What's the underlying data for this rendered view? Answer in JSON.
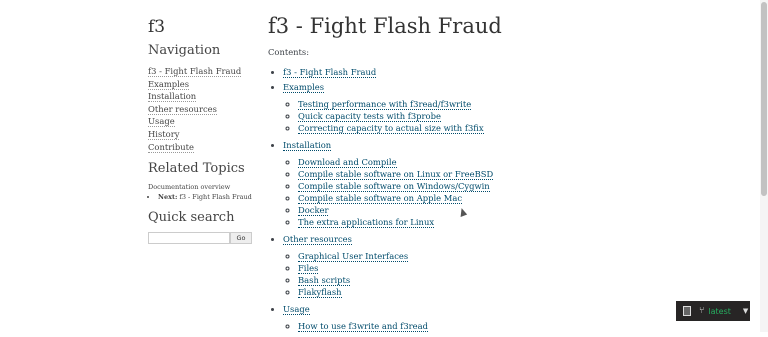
{
  "sidebar": {
    "logo": "f3",
    "navigation_heading": "Navigation",
    "nav_items": [
      "f3 - Fight Flash Fraud",
      "Examples",
      "Installation",
      "Other resources",
      "Usage",
      "History",
      "Contribute"
    ],
    "related_heading": "Related Topics",
    "related_caption": "Documentation overview",
    "related_next_label": "Next:",
    "related_next_link": "f3 - Fight Flash Fraud",
    "quick_search_heading": "Quick search",
    "search_button": "Go",
    "search_value": ""
  },
  "main": {
    "title": "f3 - Fight Flash Fraud",
    "contents_label": "Contents:",
    "toc": [
      {
        "label": "f3 - Fight Flash Fraud",
        "children": []
      },
      {
        "label": "Examples",
        "children": [
          "Testing performance with f3read/f3write",
          "Quick capacity tests with f3probe",
          "Correcting capacity to actual size with f3fix"
        ]
      },
      {
        "label": "Installation",
        "children": [
          "Download and Compile",
          "Compile stable software on Linux or FreeBSD",
          "Compile stable software on Windows/Cygwin",
          "Compile stable software on Apple Mac",
          "Docker",
          "The extra applications for Linux"
        ]
      },
      {
        "label": "Other resources",
        "children": [
          "Graphical User Interfaces",
          "Files",
          "Bash scripts",
          "Flakyflash"
        ]
      },
      {
        "label": "Usage",
        "children": [
          "How to use f3write and f3read"
        ]
      }
    ]
  },
  "badge": {
    "version": "latest",
    "book_icon": "book-icon",
    "branch_icon": "branch-icon",
    "caret_icon": "caret-down-icon"
  }
}
